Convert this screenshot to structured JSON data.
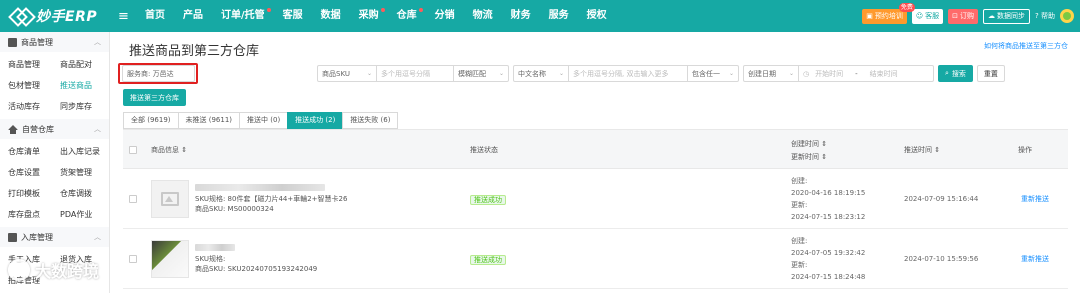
{
  "app": {
    "logo_text": "妙手ERP",
    "nav": [
      "首页",
      "产品",
      "订单/托管",
      "客服",
      "数据",
      "采购",
      "仓库",
      "分销",
      "物流",
      "财务",
      "服务",
      "授权"
    ],
    "top_right": {
      "promo_tag": "免费",
      "promo_label": "预约培训",
      "service_label": "客服",
      "order_label": "订购",
      "sync_label": "数据同步",
      "help_label": "帮助"
    }
  },
  "sidebar": {
    "groups": [
      {
        "title": "商品管理",
        "items": [
          "商品管理",
          "商品配对",
          "包材管理",
          "推送商品",
          "活动库存",
          "同步库存"
        ]
      },
      {
        "title": "自营仓库",
        "items": [
          "仓库清单",
          "出入库记录",
          "仓库设置",
          "货架管理",
          "打印模板",
          "仓库调拨",
          "库存盘点",
          "PDA作业"
        ]
      },
      {
        "title": "入库管理",
        "items": [
          "手工入库",
          "退货入库",
          "拍库管理"
        ]
      }
    ]
  },
  "page": {
    "title": "推送商品到第三方仓库",
    "help_link": "如何将商品推送至第三方仓"
  },
  "filters": {
    "supplier": "服务商: 万邑达",
    "sku_type": "商品SKU",
    "sku_placeholder": "多个用逗号分隔",
    "match_mode": "模糊匹配",
    "name_lang": "中文名称",
    "name_placeholder": "多个用逗号分隔, 双击输入更多",
    "contains": "包含任一",
    "date_type": "创建日期",
    "start_placeholder": "开始时间",
    "range_sep": "-",
    "end_placeholder": "结束时间",
    "search_label": "搜索",
    "reset_label": "重置"
  },
  "push_button": "推送第三方仓库",
  "tabs": [
    "全部 (9619)",
    "未推送 (9611)",
    "推送中 (0)",
    "推送成功 (2)",
    "推送失败 (6)"
  ],
  "table": {
    "columns": {
      "info": "商品信息 ⇕",
      "status": "推送状态",
      "created_updated_1": "创建时间 ⇕",
      "created_updated_2": "更新时间 ⇕",
      "push_time": "推送时间 ⇕",
      "action": "操作"
    },
    "rows": [
      {
        "sku_spec": "SKU规格: 80件套【磁力片44+車輪2+智慧卡26",
        "product_sku": "商品SKU: MS00000324",
        "status": "推送成功",
        "created_label": "创建:",
        "created_time": "2020-04-16 18:19:15",
        "updated_label": "更新:",
        "updated_time": "2024-07-15 18:23:12",
        "push_time": "2024-07-09 15:16:44",
        "action": "重新推送"
      },
      {
        "sku_spec": "SKU规格:",
        "product_sku": "商品SKU: SKU20240705193242049",
        "status": "推送成功",
        "created_label": "创建:",
        "created_time": "2024-07-05 19:32:42",
        "updated_label": "更新:",
        "updated_time": "2024-07-15 18:24:48",
        "push_time": "2024-07-10 15:59:56",
        "action": "重新推送"
      }
    ]
  },
  "watermark": "大数跨境"
}
